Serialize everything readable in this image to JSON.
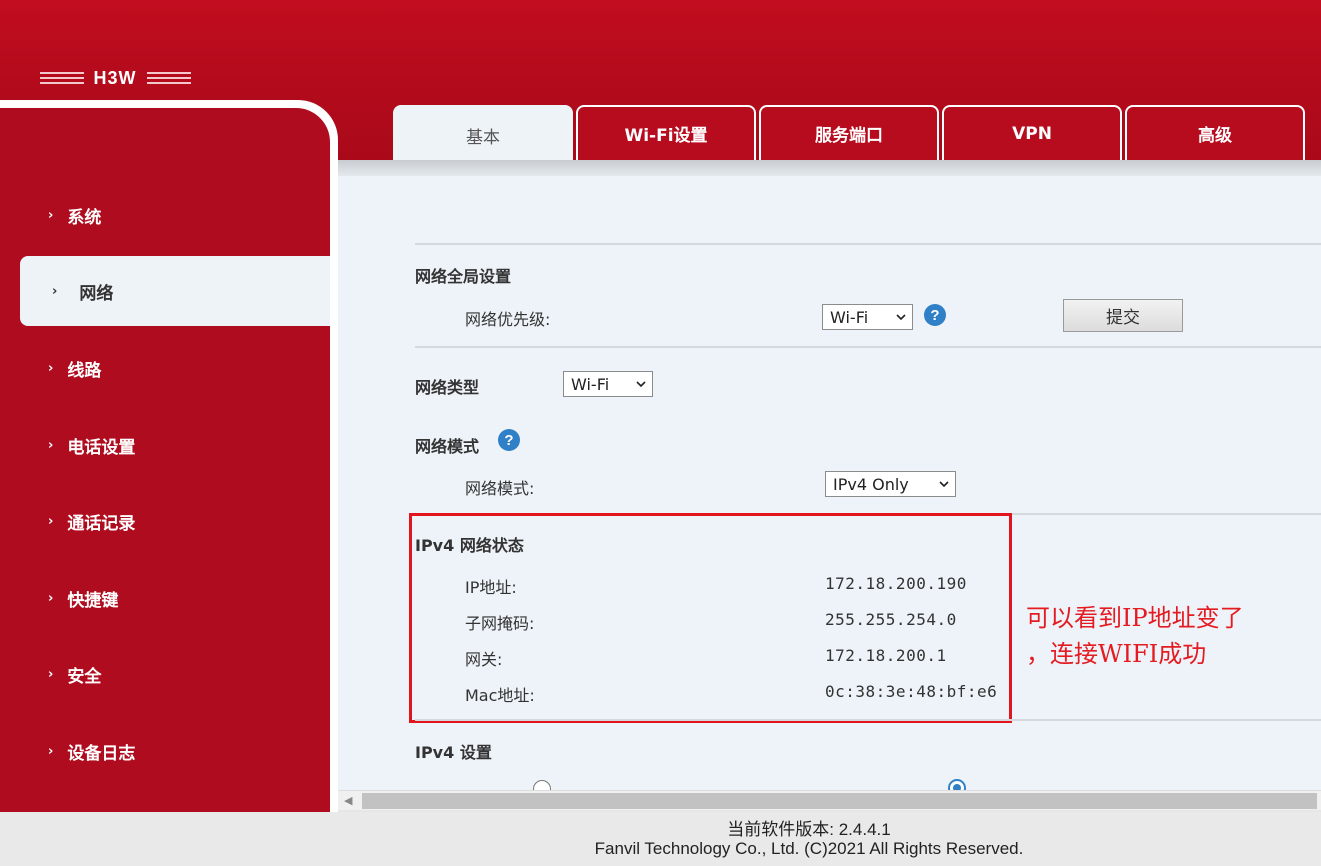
{
  "brand": {
    "name": "H3W"
  },
  "sidebar": {
    "items": [
      {
        "label": "系统"
      },
      {
        "label": "网络"
      },
      {
        "label": "线路"
      },
      {
        "label": "电话设置"
      },
      {
        "label": "通话记录"
      },
      {
        "label": "快捷键"
      },
      {
        "label": "安全"
      },
      {
        "label": "设备日志"
      }
    ],
    "active": "网络"
  },
  "tabs": [
    {
      "label": "基本"
    },
    {
      "label": "Wi-Fi设置"
    },
    {
      "label": "服务端口"
    },
    {
      "label": "VPN"
    },
    {
      "label": "高级"
    }
  ],
  "main": {
    "global": {
      "title": "网络全局设置",
      "priority_label": "网络优先级:",
      "priority_value": "Wi-Fi",
      "submit_label": "提交"
    },
    "type": {
      "title": "网络类型",
      "value": "Wi-Fi"
    },
    "mode": {
      "title": "网络模式",
      "label": "网络模式:",
      "value": "IPv4 Only"
    },
    "ipv4_status": {
      "title": "IPv4 网络状态",
      "rows": [
        {
          "label": "IP地址:",
          "value": "172.18.200.190"
        },
        {
          "label": "子网掩码:",
          "value": "255.255.254.0"
        },
        {
          "label": "网关:",
          "value": "172.18.200.1"
        },
        {
          "label": "Mac地址:",
          "value": "0c:38:3e:48:bf:e6"
        }
      ]
    },
    "ipv4_settings": {
      "title": "IPv4 设置"
    },
    "help_glyph": "?"
  },
  "annotation": {
    "line1": "可以看到IP地址变了",
    "line2": "，连接WIFI成功"
  },
  "footer": {
    "version": "当前软件版本: 2.4.4.1",
    "copyright": "Fanvil Technology Co., Ltd. (C)2021 All Rights Reserved."
  },
  "colors": {
    "header_red": "#b10a1b",
    "sidebar_red": "#b00c1f",
    "panel_bg": "#edf3f8",
    "annotation_red": "#e51b22",
    "help_blue": "#2f80c7"
  }
}
